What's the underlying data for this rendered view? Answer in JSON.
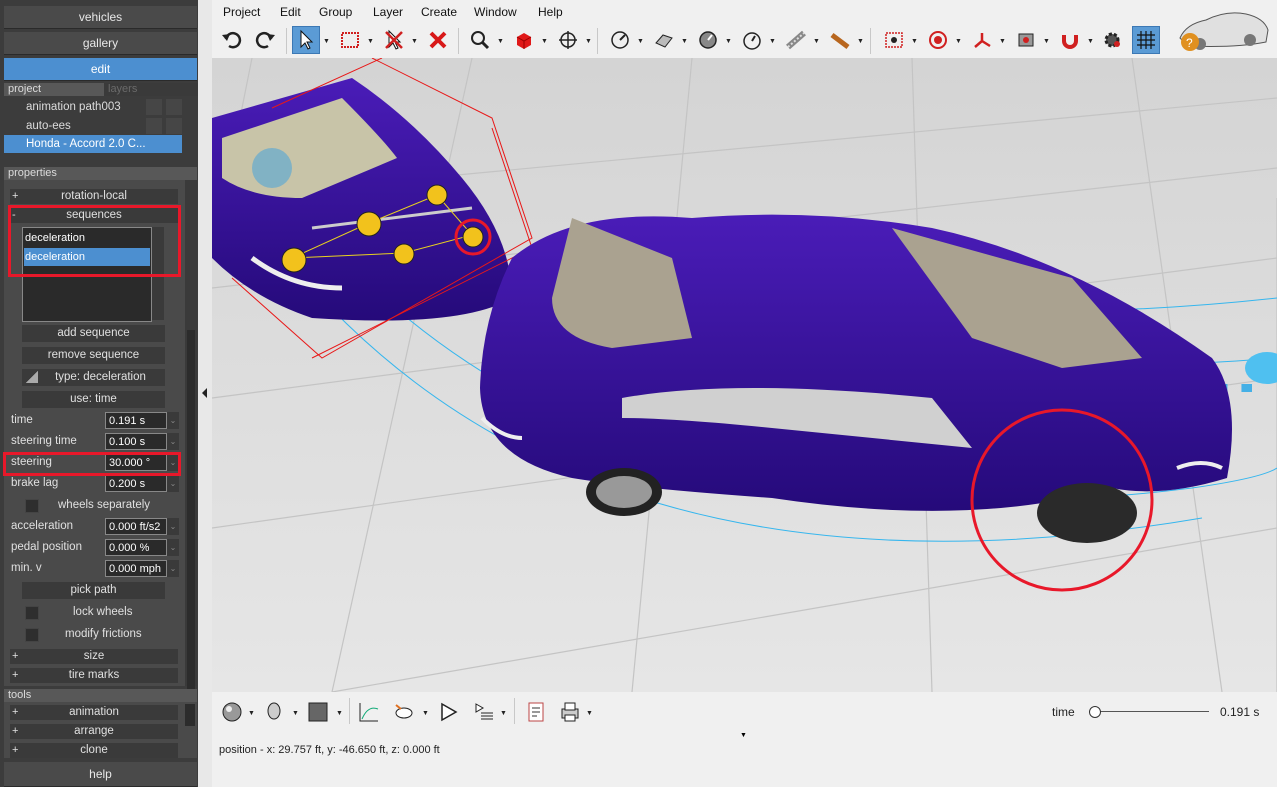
{
  "nav": {
    "vehicles": "vehicles",
    "gallery": "gallery",
    "edit": "edit",
    "help": "help"
  },
  "project_tabs": {
    "project": "project",
    "layers": "layers"
  },
  "project_items": [
    "animation path003",
    "auto-ees",
    "Honda - Accord 2.0 C..."
  ],
  "properties_header": "properties",
  "groups": {
    "rotation_local": "rotation-local",
    "sequences": "sequences",
    "size": "size",
    "tire_marks": "tire marks"
  },
  "sequences_list": [
    "deceleration",
    "deceleration"
  ],
  "buttons": {
    "add_sequence": "add sequence",
    "remove_sequence": "remove sequence",
    "type": "type: deceleration",
    "use": "use: time",
    "pick_path": "pick path"
  },
  "fields": [
    {
      "label": "time",
      "value": "0.191 s"
    },
    {
      "label": "steering time",
      "value": "0.100 s"
    },
    {
      "label": "steering",
      "value": "30.000 °"
    },
    {
      "label": "brake lag",
      "value": "0.200 s"
    }
  ],
  "fields2": [
    {
      "label": "acceleration",
      "value": "0.000 ft/s2"
    },
    {
      "label": "pedal position",
      "value": "0.000 %"
    },
    {
      "label": "min. v",
      "value": "0.000 mph"
    }
  ],
  "checks": {
    "wheels_separately": "wheels separately",
    "lock_wheels": "lock wheels",
    "modify_frictions": "modify frictions"
  },
  "tools_header": "tools",
  "tools": [
    "animation",
    "arrange",
    "clone"
  ],
  "menus": [
    "Project",
    "Edit",
    "Group",
    "Layer",
    "Create",
    "Window",
    "Help"
  ],
  "status": {
    "time_label": "time",
    "time_value": "0.191 s",
    "position": "position - x: 29.757 ft, y: -46.650 ft, z: 0.000 ft"
  },
  "colors": {
    "accent": "#4c8fd0",
    "panel": "#3c3c3c",
    "highlight": "#e8182a",
    "car": "#3a0f9a"
  }
}
